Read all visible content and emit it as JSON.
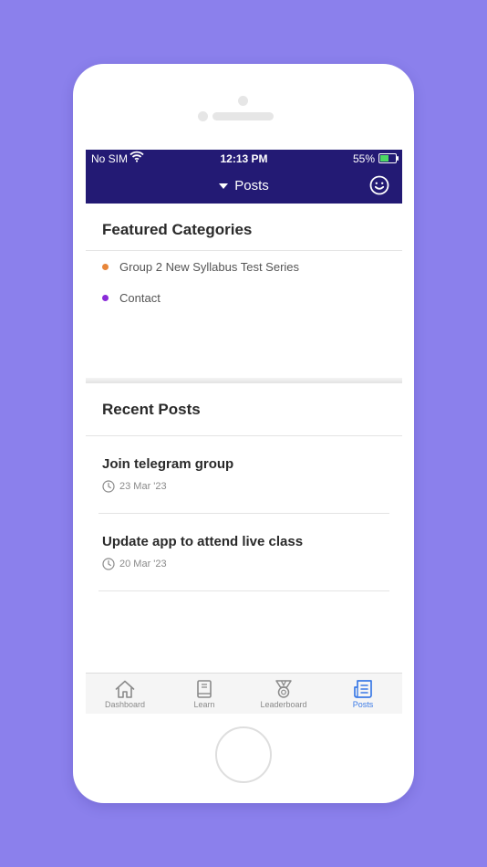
{
  "status_bar": {
    "carrier": "No SIM",
    "time": "12:13 PM",
    "battery": "55%"
  },
  "navbar": {
    "title": "Posts"
  },
  "featured": {
    "title": "Featured Categories",
    "items": [
      {
        "label": "Group 2 New Syllabus Test Series",
        "color": "#e8863a"
      },
      {
        "label": "Contact",
        "color": "#8a2bd8"
      }
    ]
  },
  "recent": {
    "title": "Recent Posts",
    "posts": [
      {
        "title": "Join telegram group",
        "date": "23 Mar '23"
      },
      {
        "title": "Update app to attend live class",
        "date": "20 Mar '23"
      }
    ]
  },
  "tabs": [
    {
      "label": "Dashboard",
      "icon": "home-icon",
      "active": false
    },
    {
      "label": "Learn",
      "icon": "book-icon",
      "active": false
    },
    {
      "label": "Leaderboard",
      "icon": "medal-icon",
      "active": false
    },
    {
      "label": "Posts",
      "icon": "posts-icon",
      "active": true
    }
  ],
  "colors": {
    "background": "#8b80ec",
    "header": "#231a74",
    "accent": "#3b7ae6"
  }
}
